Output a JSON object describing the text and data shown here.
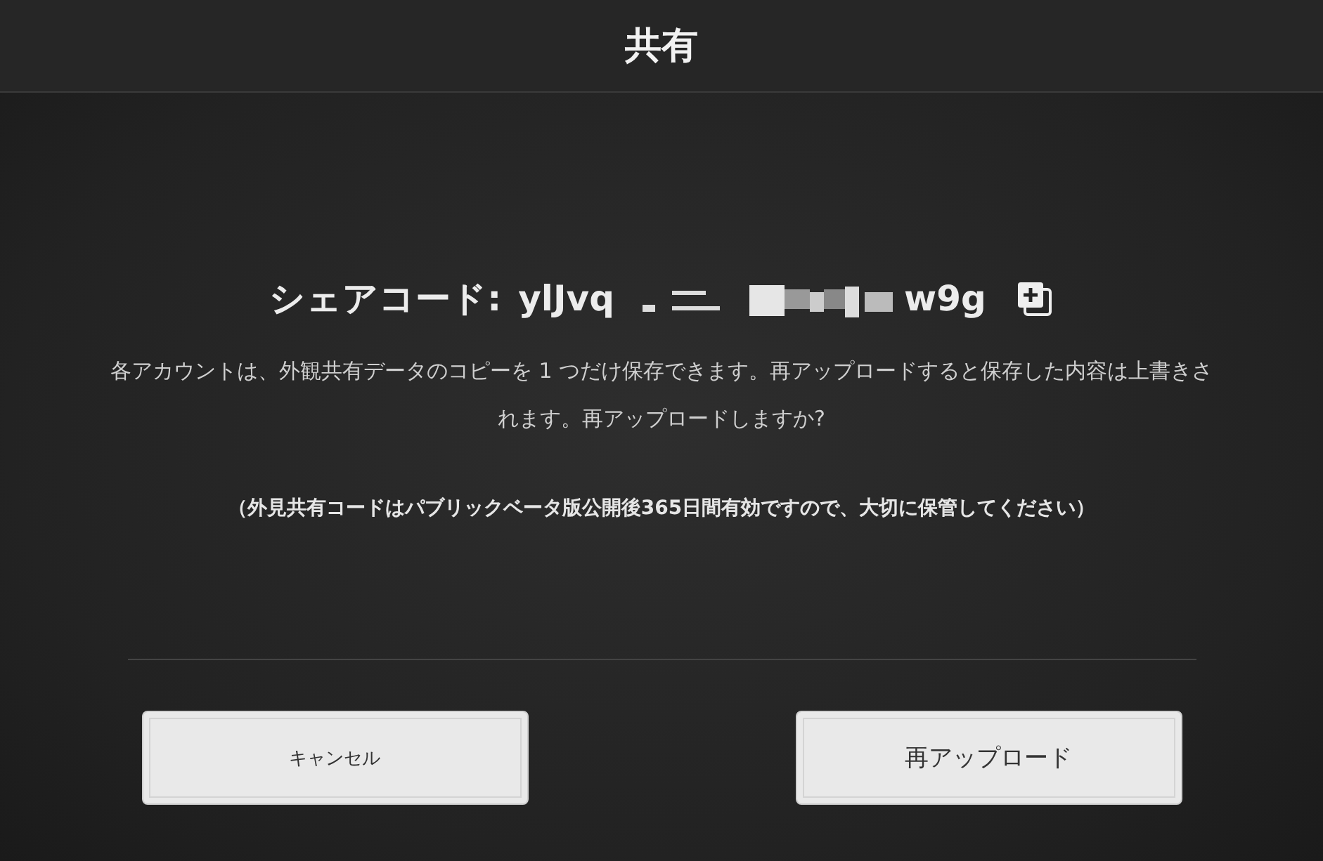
{
  "header": {
    "title": "共有"
  },
  "share_code": {
    "label": "シェアコード:",
    "code_start": "ylJvq",
    "code_end": "w9g"
  },
  "message": "各アカウントは、外観共有データのコピーを 1 つだけ保存できます。再アップロードすると保存した内容は上書きされます。再アップロードしますか?",
  "note": "（外見共有コードはパブリックベータ版公開後365日間有効ですので、大切に保管してください）",
  "buttons": [
    {
      "label": "キャンセル",
      "kind": "secondary"
    },
    {
      "label": "再アップロード",
      "kind": "primary"
    }
  ]
}
